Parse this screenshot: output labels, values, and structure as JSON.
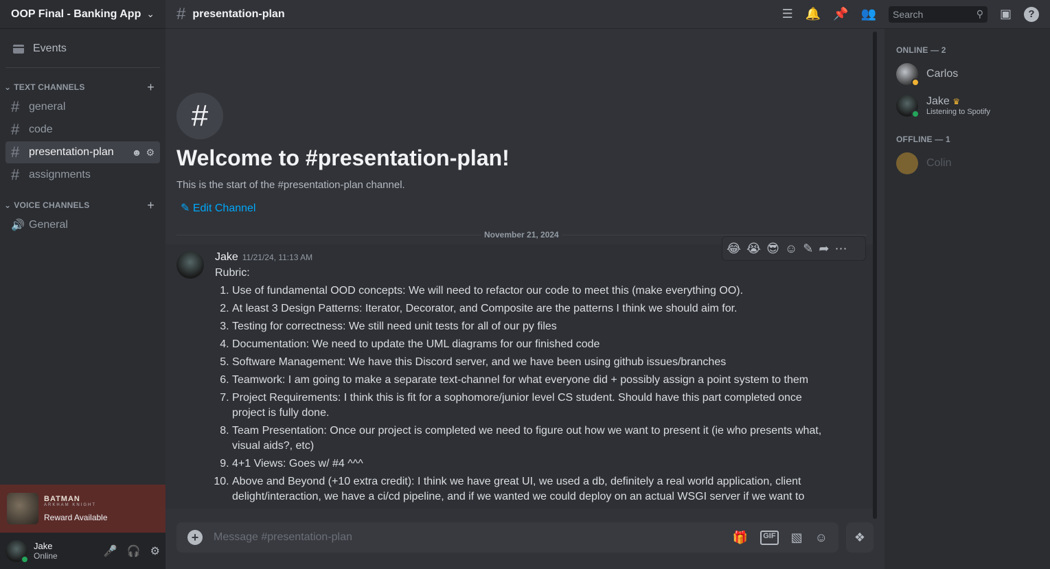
{
  "server": {
    "name": "OOP Final - Banking App"
  },
  "sidebar": {
    "events_label": "Events",
    "text_category": "TEXT CHANNELS",
    "voice_category": "VOICE CHANNELS",
    "text_channels": [
      "general",
      "code",
      "presentation-plan",
      "assignments"
    ],
    "voice_channels": [
      "General"
    ]
  },
  "promo": {
    "brand": "BATMAN",
    "sub": "ARKHAM KNIGHT",
    "reward": "Reward Available"
  },
  "user": {
    "name": "Jake",
    "status": "Online"
  },
  "topbar": {
    "channel": "presentation-plan",
    "search_placeholder": "Search"
  },
  "welcome": {
    "title": "Welcome to #presentation-plan!",
    "subtitle": "This is the start of the #presentation-plan channel.",
    "edit": "Edit Channel"
  },
  "date_divider": "November 21, 2024",
  "message": {
    "author": "Jake",
    "timestamp": "11/21/24, 11:13 AM",
    "intro": "Rubric:",
    "items": [
      "Use of fundamental OOD concepts: We will need to refactor our code to meet this (make everything OO).",
      "At least 3 Design Patterns: Iterator, Decorator, and Composite are the patterns I think we should aim for.",
      "Testing for correctness: We still need unit tests for all of our py files",
      "Documentation: We need to update the UML diagrams for our finished code",
      "Software Management: We have this Discord server, and we have been using github issues/branches",
      "Teamwork: I am going to make a separate text-channel for what everyone did + possibly assign a point system to them",
      "Project Requirements: I think this is fit for a sophomore/junior level CS student. Should have this part completed once project is fully done.",
      "Team Presentation: Once our project is completed we need to figure out how we want to present it (ie who presents what, visual aids?, etc)",
      "4+1 Views: Goes w/ #4 ^^^",
      "Above and Beyond (+10 extra credit): I think we have great UI, we used a db, definitely a real world application, client delight/interaction, we have a ci/cd pipeline, and if we wanted we could deploy on an actual WSGI server if we want to"
    ]
  },
  "composer": {
    "placeholder": "Message #presentation-plan",
    "gif": "GIF"
  },
  "members": {
    "online_header": "ONLINE — 2",
    "offline_header": "OFFLINE — 1",
    "online": [
      {
        "name": "Carlos",
        "activity": ""
      },
      {
        "name": "Jake",
        "activity": "Listening to Spotify"
      }
    ],
    "offline": [
      {
        "name": "Colin"
      }
    ]
  },
  "colors": {
    "accent": "#00a8fc",
    "online": "#23a55a",
    "idle": "#f0b232",
    "promo": "#5b2b28"
  }
}
